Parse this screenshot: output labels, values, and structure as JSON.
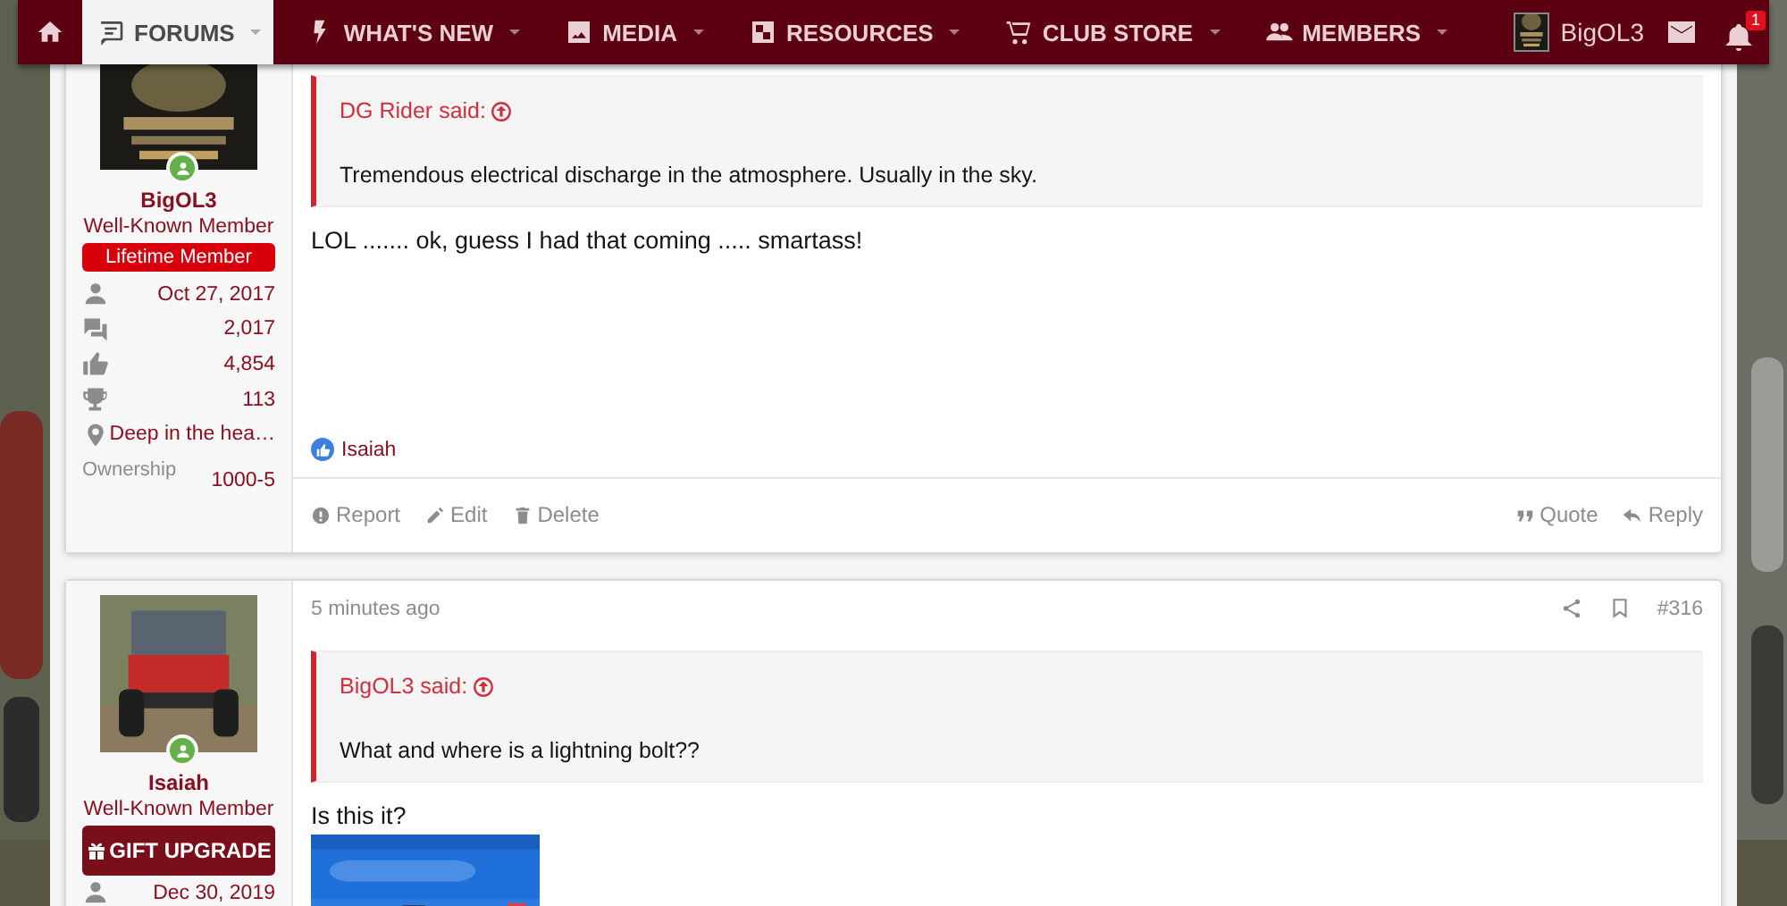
{
  "nav": {
    "tabs": [
      {
        "kind": "home",
        "selected": false
      },
      {
        "kind": "forums",
        "label": "FORUMS",
        "selected": true
      },
      {
        "kind": "whats_new",
        "label": "WHAT'S NEW",
        "selected": false
      },
      {
        "kind": "media",
        "label": "MEDIA",
        "selected": false
      },
      {
        "kind": "resources",
        "label": "RESOURCES",
        "selected": false
      },
      {
        "kind": "store",
        "label": "CLUB STORE",
        "selected": false
      },
      {
        "kind": "members",
        "label": "MEMBERS",
        "selected": false
      }
    ],
    "account": {
      "name": "BigOL3",
      "alerts": "1"
    }
  },
  "posts": [
    {
      "user": {
        "name": "BigOL3",
        "title": "Well-Known Member",
        "online": true,
        "banner": {
          "kind": "badge",
          "text": "Lifetime Member"
        },
        "stats": [
          {
            "kind": "joined",
            "value": "Oct 27, 2017"
          },
          {
            "kind": "messages",
            "value": "2,017"
          },
          {
            "kind": "reactions",
            "value": "4,854"
          },
          {
            "kind": "points",
            "value": "113"
          },
          {
            "kind": "location",
            "value": "Deep in the hea…"
          }
        ],
        "fields": [
          {
            "label": "Ownership",
            "value": "1000-5"
          }
        ]
      },
      "quote": {
        "author": "DG Rider said:",
        "text": "Tremendous electrical discharge in the atmosphere. Usually in the sky."
      },
      "body": "LOL ....... ok, guess I had that coming ..... smartass!",
      "reaction": "Isaiah",
      "actions_left": [
        {
          "kind": "report",
          "label": "Report"
        },
        {
          "kind": "edit",
          "label": "Edit"
        },
        {
          "kind": "delete",
          "label": "Delete"
        }
      ],
      "actions_right": [
        {
          "kind": "quote",
          "label": "Quote"
        },
        {
          "kind": "reply",
          "label": "Reply"
        }
      ]
    },
    {
      "user": {
        "name": "Isaiah",
        "title": "Well-Known Member",
        "online": true,
        "banner": {
          "kind": "button",
          "text": "GIFT UPGRADE"
        },
        "stats": [
          {
            "kind": "joined",
            "value": "Dec 30, 2019"
          }
        ]
      },
      "date": "5 minutes ago",
      "number": "#316",
      "quote": {
        "author": "BigOL3 said:",
        "text": "What and where is a lightning bolt??"
      },
      "body": "Is this it?"
    }
  ]
}
